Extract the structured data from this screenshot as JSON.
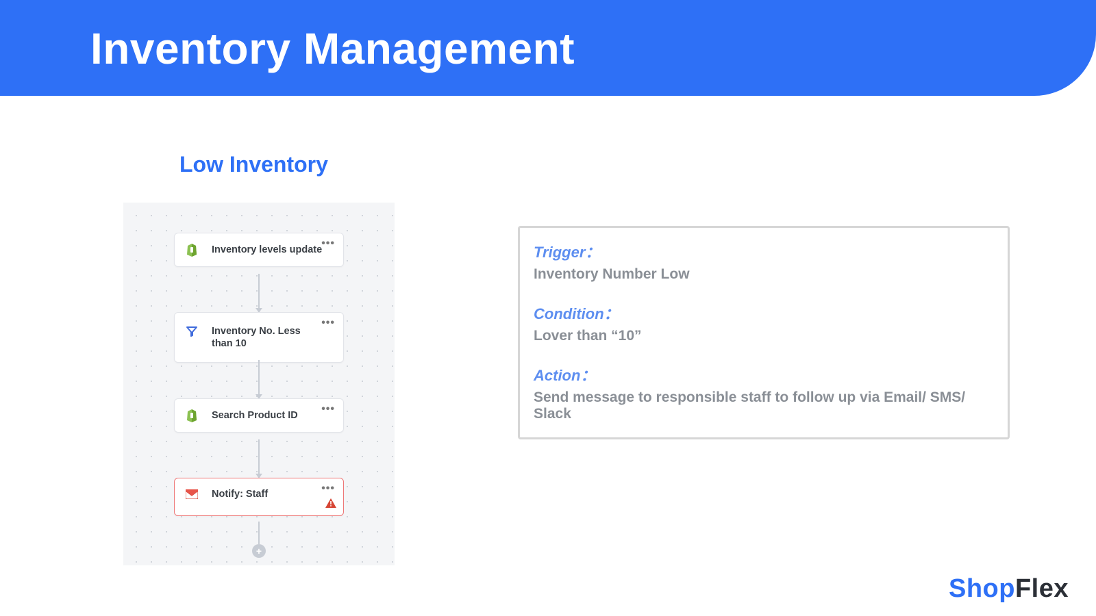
{
  "header": {
    "title": "Inventory Management"
  },
  "subtitle": "Low Inventory",
  "flow": {
    "nodes": [
      {
        "label": "Inventory levels update",
        "icon": "shopify"
      },
      {
        "label": "Inventory No. Less than 10",
        "icon": "filter"
      },
      {
        "label": "Search Product ID",
        "icon": "shopify"
      },
      {
        "label": "Notify: Staff",
        "icon": "mail",
        "alert": true
      }
    ],
    "add_label": "+"
  },
  "panel": {
    "trigger_label": "Trigger：",
    "trigger_value": "Inventory Number Low",
    "condition_label": "Condition：",
    "condition_value": "Lover than “10”",
    "action_label": "Action：",
    "action_value": "Send message to responsible staff to follow up via Email/ SMS/ Slack"
  },
  "brand": {
    "part1": "Shop",
    "part2": "Flex"
  }
}
